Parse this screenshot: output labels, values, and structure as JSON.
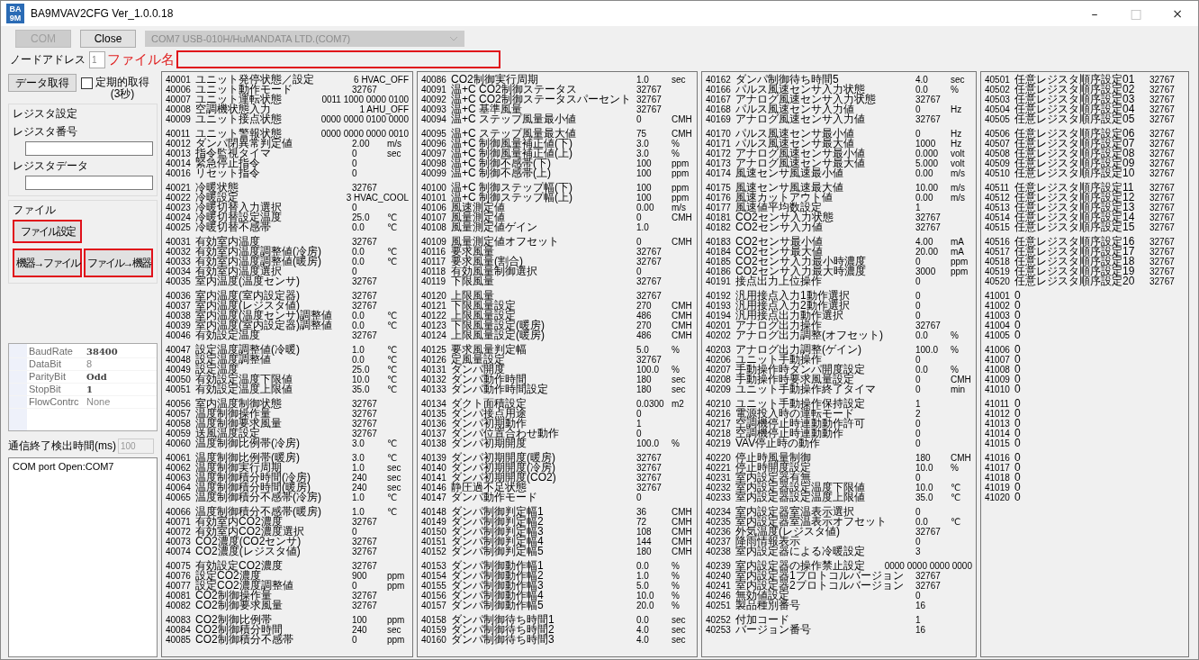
{
  "window": {
    "title": "BA9MVAV2CFG Ver_1.0.0.18",
    "icon_text": [
      "BA",
      "9M"
    ],
    "controls": [
      "–",
      "□",
      "×"
    ]
  },
  "connection": {
    "com_button": {
      "label": "COM",
      "disabled": true
    },
    "close_button": {
      "label": "Close",
      "disabled": false
    },
    "port_select": {
      "value": "COM7 USB-010H/HuMANDATA LTD.(COM7)",
      "disabled": true
    }
  },
  "node_address": {
    "label": "ノードアドレス",
    "value": "1"
  },
  "file_name": {
    "label": "ファイル名",
    "highlighted": true
  },
  "fetch_button": {
    "label": "データ取得"
  },
  "periodic": {
    "label": "定期的取得",
    "sublabel": "(3秒)",
    "checked": false
  },
  "register_settings": {
    "title": "レジスタ設定",
    "fields": [
      {
        "label": "レジスタ番号"
      },
      {
        "label": "レジスタデータ"
      }
    ]
  },
  "file": {
    "title": "ファイル",
    "buttons": [
      {
        "label": "ファイル設定",
        "highlighted": true
      },
      {
        "label": "機器→ファイル",
        "highlighted": true
      },
      {
        "label": "ファイル→機器",
        "highlighted": true
      }
    ]
  },
  "serial_properties": [
    {
      "name": "BaudRate",
      "value": "38400",
      "modified": true
    },
    {
      "name": "DataBit",
      "value": "8",
      "modified": false
    },
    {
      "name": "ParityBit",
      "value": "Odd",
      "modified": true
    },
    {
      "name": "StopBit",
      "value": "1",
      "modified": true
    },
    {
      "name": "FlowContrc",
      "value": "None",
      "modified": false
    }
  ],
  "timeout": {
    "label": "通信終了検出時間(ms)",
    "value": "100",
    "disabled": true
  },
  "log": [
    "COM port Open:COM7"
  ],
  "panels": [
    {
      "groups": [
        [
          {
            "reg": "40001",
            "name": "ユニット発停状態／設定",
            "value": "6 HVAC_OFF"
          },
          {
            "reg": "40006",
            "name": "ユニット動作モード",
            "value": "32767"
          },
          {
            "reg": "40007",
            "name": "ユニット運転状態",
            "value": "0011 1000 0000 0100"
          },
          {
            "reg": "40008",
            "name": "空調機状態入力",
            "value": "1 AHU_OFF"
          },
          {
            "reg": "40009",
            "name": "ユニット接点状態",
            "value": "0000 0000 0100 0000"
          }
        ],
        [
          {
            "reg": "40011",
            "name": "ユニット警報状態",
            "value": "0000 0000 0000 0010"
          },
          {
            "reg": "40012",
            "name": "ダンパ閉異常判定値",
            "value": "2.00",
            "unit": "m/s"
          },
          {
            "reg": "40013",
            "name": "指令監視タイマ",
            "value": "0",
            "unit": "sec"
          },
          {
            "reg": "40014",
            "name": "緊急停止指令",
            "value": "0"
          },
          {
            "reg": "40016",
            "name": "リセット指令",
            "value": "0"
          }
        ],
        [
          {
            "reg": "40021",
            "name": "冷暖状態",
            "value": "32767"
          },
          {
            "reg": "40022",
            "name": "冷暖設定",
            "value": "3 HVAC_COOL"
          },
          {
            "reg": "40023",
            "name": "冷暖切替入力選択",
            "value": "0"
          },
          {
            "reg": "40024",
            "name": "冷暖切替設定温度",
            "value": "25.0",
            "unit": "℃"
          },
          {
            "reg": "40025",
            "name": "冷暖切替不感帯",
            "value": "0.0",
            "unit": "℃"
          }
        ],
        [
          {
            "reg": "40031",
            "name": "有効室内温度",
            "value": "32767"
          },
          {
            "reg": "40032",
            "name": "有効室内温度調整値(冷房)",
            "value": "0.0",
            "unit": "℃"
          },
          {
            "reg": "40033",
            "name": "有効室内温度調整値(暖房)",
            "value": "0.0",
            "unit": "℃"
          },
          {
            "reg": "40034",
            "name": "有効室内温度選択",
            "value": "0"
          },
          {
            "reg": "40035",
            "name": "室内温度(温度センサ)",
            "value": "32767"
          }
        ],
        [
          {
            "reg": "40036",
            "name": "室内温度(室内設定器)",
            "value": "32767"
          },
          {
            "reg": "40037",
            "name": "室内温度(レジスタ値)",
            "value": "32767"
          },
          {
            "reg": "40038",
            "name": "室内温度(温度センサ)調整値",
            "value": "0.0",
            "unit": "℃"
          },
          {
            "reg": "40039",
            "name": "室内温度(室内設定器)調整値",
            "value": "0.0",
            "unit": "℃"
          },
          {
            "reg": "40046",
            "name": "有効設定温度",
            "value": "32767"
          }
        ],
        [
          {
            "reg": "40047",
            "name": "設定温度調整値(冷暖)",
            "value": "1.0",
            "unit": "℃"
          },
          {
            "reg": "40048",
            "name": "設定温度調整値",
            "value": "0.0",
            "unit": "℃"
          },
          {
            "reg": "40049",
            "name": "設定温度",
            "value": "25.0",
            "unit": "℃"
          },
          {
            "reg": "40050",
            "name": "有効設定温度下限値",
            "value": "10.0",
            "unit": "℃"
          },
          {
            "reg": "40051",
            "name": "有効設定温度上限値",
            "value": "35.0",
            "unit": "℃"
          }
        ],
        [
          {
            "reg": "40056",
            "name": "室内温度制御状態",
            "value": "32767"
          },
          {
            "reg": "40057",
            "name": "温度制御操作量",
            "value": "32767"
          },
          {
            "reg": "40058",
            "name": "温度制御要求風量",
            "value": "32767"
          },
          {
            "reg": "40059",
            "name": "送風温度設定",
            "value": "32767"
          },
          {
            "reg": "40060",
            "name": "温度制御比例帯(冷房)",
            "value": "3.0",
            "unit": "℃"
          }
        ],
        [
          {
            "reg": "40061",
            "name": "温度制御比例帯(暖房)",
            "value": "3.0",
            "unit": "℃"
          },
          {
            "reg": "40062",
            "name": "温度制御実行周期",
            "value": "1.0",
            "unit": "sec"
          },
          {
            "reg": "40063",
            "name": "温度制御積分時間(冷房)",
            "value": "240",
            "unit": "sec"
          },
          {
            "reg": "40064",
            "name": "温度制御積分時間(暖房)",
            "value": "240",
            "unit": "sec"
          },
          {
            "reg": "40065",
            "name": "温度制御積分不感帯(冷房)",
            "value": "1.0",
            "unit": "℃"
          }
        ],
        [
          {
            "reg": "40066",
            "name": "温度制御積分不感帯(暖房)",
            "value": "1.0",
            "unit": "℃"
          },
          {
            "reg": "40071",
            "name": "有効室内CO2濃度",
            "value": "32767"
          },
          {
            "reg": "40072",
            "name": "有効室内CO2濃度選択",
            "value": "0"
          },
          {
            "reg": "40073",
            "name": "CO2濃度(CO2センサ)",
            "value": "32767"
          },
          {
            "reg": "40074",
            "name": "CO2濃度(レジスタ値)",
            "value": "32767"
          }
        ],
        [
          {
            "reg": "40075",
            "name": "有効設定CO2濃度",
            "value": "32767"
          },
          {
            "reg": "40076",
            "name": "設定CO2濃度",
            "value": "900",
            "unit": "ppm"
          },
          {
            "reg": "40077",
            "name": "設定CO2濃度調整値",
            "value": "0",
            "unit": "ppm"
          },
          {
            "reg": "40081",
            "name": "CO2制御操作量",
            "value": "32767"
          },
          {
            "reg": "40082",
            "name": "CO2制御要求風量",
            "value": "32767"
          }
        ],
        [
          {
            "reg": "40083",
            "name": "CO2制御比例帯",
            "value": "100",
            "unit": "ppm"
          },
          {
            "reg": "40084",
            "name": "CO2制御積分時間",
            "value": "240",
            "unit": "sec"
          },
          {
            "reg": "40085",
            "name": "CO2制御積分不感帯",
            "value": "0",
            "unit": "ppm"
          }
        ]
      ]
    },
    {
      "groups": [
        [
          {
            "reg": "40086",
            "name": "CO2制御実行周期",
            "value": "1.0",
            "unit": "sec"
          },
          {
            "reg": "40091",
            "name": "温+C CO2制御ステータス",
            "value": "32767"
          },
          {
            "reg": "40092",
            "name": "温+C CO2制御ステータスパーセント",
            "value": "32767"
          },
          {
            "reg": "40093",
            "name": "温+C 基準風量",
            "value": "32767"
          },
          {
            "reg": "40094",
            "name": "温+C ステップ風量最小値",
            "value": "0",
            "unit": "CMH"
          }
        ],
        [
          {
            "reg": "40095",
            "name": "温+C ステップ風量最大値",
            "value": "75",
            "unit": "CMH"
          },
          {
            "reg": "40096",
            "name": "温+C 制御風量補正値(下)",
            "value": "3.0",
            "unit": "%"
          },
          {
            "reg": "40097",
            "name": "温+C 制御風量補正値(上)",
            "value": "3.0",
            "unit": "%"
          },
          {
            "reg": "40098",
            "name": "温+C 制御不感帯(下)",
            "value": "100",
            "unit": "ppm"
          },
          {
            "reg": "40099",
            "name": "温+C 制御不感帯(上)",
            "value": "100",
            "unit": "ppm"
          }
        ],
        [
          {
            "reg": "40100",
            "name": "温+C 制御ステップ幅(下)",
            "value": "100",
            "unit": "ppm"
          },
          {
            "reg": "40101",
            "name": "温+C 制御ステップ幅(上)",
            "value": "100",
            "unit": "ppm"
          },
          {
            "reg": "40106",
            "name": "風速測定値",
            "value": "0.00",
            "unit": "m/s"
          },
          {
            "reg": "40107",
            "name": "風量測定値",
            "value": "0",
            "unit": "CMH"
          },
          {
            "reg": "40108",
            "name": "風量測定値ゲイン",
            "value": "1.0"
          }
        ],
        [
          {
            "reg": "40109",
            "name": "風量測定値オフセット",
            "value": "0",
            "unit": "CMH"
          },
          {
            "reg": "40116",
            "name": "要求風量",
            "value": "32767"
          },
          {
            "reg": "40117",
            "name": "要求風量(割合)",
            "value": "32767"
          },
          {
            "reg": "40118",
            "name": "有効風量制御選択",
            "value": "0"
          },
          {
            "reg": "40119",
            "name": "下限風量",
            "value": "32767"
          }
        ],
        [
          {
            "reg": "40120",
            "name": "上限風量",
            "value": "32767"
          },
          {
            "reg": "40121",
            "name": "下限風量設定",
            "value": "270",
            "unit": "CMH"
          },
          {
            "reg": "40122",
            "name": "上限風量設定",
            "value": "486",
            "unit": "CMH"
          },
          {
            "reg": "40123",
            "name": "下限風量設定(暖房)",
            "value": "270",
            "unit": "CMH"
          },
          {
            "reg": "40124",
            "name": "上限風量設定(暖房)",
            "value": "486",
            "unit": "CMH"
          }
        ],
        [
          {
            "reg": "40125",
            "name": "要求風量判定幅",
            "value": "5.0",
            "unit": "%"
          },
          {
            "reg": "40126",
            "name": "定風量設定",
            "value": "32767"
          },
          {
            "reg": "40131",
            "name": "ダンパ開度",
            "value": "100.0",
            "unit": "%"
          },
          {
            "reg": "40132",
            "name": "ダンパ動作時間",
            "value": "180",
            "unit": "sec"
          },
          {
            "reg": "40133",
            "name": "ダンパ動作時間設定",
            "value": "180",
            "unit": "sec"
          }
        ],
        [
          {
            "reg": "40134",
            "name": "ダクト面積設定",
            "value": "0.0300",
            "unit": "m2"
          },
          {
            "reg": "40135",
            "name": "ダンパ接点用途",
            "value": "0"
          },
          {
            "reg": "40136",
            "name": "ダンパ初期動作",
            "value": "1"
          },
          {
            "reg": "40137",
            "name": "ダンパ位置合わせ動作",
            "value": "0"
          },
          {
            "reg": "40138",
            "name": "ダンパ初期開度",
            "value": "100.0",
            "unit": "%"
          }
        ],
        [
          {
            "reg": "40139",
            "name": "ダンパ初期開度(暖房)",
            "value": "32767"
          },
          {
            "reg": "40140",
            "name": "ダンパ初期開度(冷房)",
            "value": "32767"
          },
          {
            "reg": "40141",
            "name": "ダンパ初期開度(CO2)",
            "value": "32767"
          },
          {
            "reg": "40146",
            "name": "静圧過不足状態",
            "value": "32767"
          },
          {
            "reg": "40147",
            "name": "ダンパ動作モード",
            "value": "0"
          }
        ],
        [
          {
            "reg": "40148",
            "name": "ダンパ制御判定幅1",
            "value": "36",
            "unit": "CMH"
          },
          {
            "reg": "40149",
            "name": "ダンパ制御判定幅2",
            "value": "72",
            "unit": "CMH"
          },
          {
            "reg": "40150",
            "name": "ダンパ制御判定幅3",
            "value": "108",
            "unit": "CMH"
          },
          {
            "reg": "40151",
            "name": "ダンパ制御判定幅4",
            "value": "144",
            "unit": "CMH"
          },
          {
            "reg": "40152",
            "name": "ダンパ制御判定幅5",
            "value": "180",
            "unit": "CMH"
          }
        ],
        [
          {
            "reg": "40153",
            "name": "ダンパ制御動作幅1",
            "value": "0.0",
            "unit": "%"
          },
          {
            "reg": "40154",
            "name": "ダンパ制御動作幅2",
            "value": "1.0",
            "unit": "%"
          },
          {
            "reg": "40155",
            "name": "ダンパ制御動作幅3",
            "value": "5.0",
            "unit": "%"
          },
          {
            "reg": "40156",
            "name": "ダンパ制御動作幅4",
            "value": "10.0",
            "unit": "%"
          },
          {
            "reg": "40157",
            "name": "ダンパ制御動作幅5",
            "value": "20.0",
            "unit": "%"
          }
        ],
        [
          {
            "reg": "40158",
            "name": "ダンパ制御待ち時間1",
            "value": "0.0",
            "unit": "sec"
          },
          {
            "reg": "40159",
            "name": "ダンパ制御待ち時間2",
            "value": "4.0",
            "unit": "sec"
          },
          {
            "reg": "40160",
            "name": "ダンパ制御待ち時間3",
            "value": "4.0",
            "unit": "sec"
          }
        ]
      ]
    },
    {
      "groups": [
        [
          {
            "reg": "40162",
            "name": "ダンパ制御待ち時間5",
            "value": "4.0",
            "unit": "sec"
          },
          {
            "reg": "40166",
            "name": "パルス風速センサ入力状態",
            "value": "0.0",
            "unit": "%"
          },
          {
            "reg": "40167",
            "name": "アナログ風速センサ入力状態",
            "value": "32767"
          },
          {
            "reg": "40168",
            "name": "パルス風速センサ入力値",
            "value": "0",
            "unit": "Hz"
          },
          {
            "reg": "40169",
            "name": "アナログ風速センサ入力値",
            "value": "32767"
          }
        ],
        [
          {
            "reg": "40170",
            "name": "パルス風速センサ最小値",
            "value": "0",
            "unit": "Hz"
          },
          {
            "reg": "40171",
            "name": "パルス風速センサ最大値",
            "value": "1000",
            "unit": "Hz"
          },
          {
            "reg": "40172",
            "name": "アナログ風速センサ最小値",
            "value": "0.000",
            "unit": "volt"
          },
          {
            "reg": "40173",
            "name": "アナログ風速センサ最大値",
            "value": "5.000",
            "unit": "volt"
          },
          {
            "reg": "40174",
            "name": "風速センサ風速最小値",
            "value": "0.00",
            "unit": "m/s"
          }
        ],
        [
          {
            "reg": "40175",
            "name": "風速センサ風速最大値",
            "value": "10.00",
            "unit": "m/s"
          },
          {
            "reg": "40176",
            "name": "風速カットアウト値",
            "value": "0.00",
            "unit": "m/s"
          },
          {
            "reg": "40177",
            "name": "風速値平均数設定",
            "value": "1"
          },
          {
            "reg": "40181",
            "name": "CO2センサ入力状態",
            "value": "32767"
          },
          {
            "reg": "40182",
            "name": "CO2センサ入力値",
            "value": "32767"
          }
        ],
        [
          {
            "reg": "40183",
            "name": "CO2センサ最小値",
            "value": "4.00",
            "unit": "mA"
          },
          {
            "reg": "40184",
            "name": "CO2センサ最大値",
            "value": "20.00",
            "unit": "mA"
          },
          {
            "reg": "40185",
            "name": "CO2センサ入力最小時濃度",
            "value": "0",
            "unit": "ppm"
          },
          {
            "reg": "40186",
            "name": "CO2センサ入力最大時濃度",
            "value": "3000",
            "unit": "ppm"
          },
          {
            "reg": "40191",
            "name": "接点出力上位操作",
            "value": "0"
          }
        ],
        [
          {
            "reg": "40192",
            "name": "汎用接点入力1動作選択",
            "value": "0"
          },
          {
            "reg": "40193",
            "name": "汎用接点入力2動作選択",
            "value": "0"
          },
          {
            "reg": "40194",
            "name": "汎用接点出力動作選択",
            "value": "0"
          },
          {
            "reg": "40201",
            "name": "アナログ出力操作",
            "value": "32767"
          },
          {
            "reg": "40202",
            "name": "アナログ出力調整(オフセット)",
            "value": "0.0",
            "unit": "%"
          }
        ],
        [
          {
            "reg": "40203",
            "name": "アナログ出力調整(ゲイン)",
            "value": "100.0",
            "unit": "%"
          },
          {
            "reg": "40206",
            "name": "ユニット手動操作",
            "value": "0"
          },
          {
            "reg": "40207",
            "name": "手動操作時ダンパ開度設定",
            "value": "0.0",
            "unit": "%"
          },
          {
            "reg": "40208",
            "name": "手動操作時要求風量設定",
            "value": "0",
            "unit": "CMH"
          },
          {
            "reg": "40209",
            "name": "ユニット手動操作終了タイマ",
            "value": "0",
            "unit": "min"
          }
        ],
        [
          {
            "reg": "40210",
            "name": "ユニット手動操作保持設定",
            "value": "1"
          },
          {
            "reg": "40216",
            "name": "電源投入時の運転モード",
            "value": "2"
          },
          {
            "reg": "40217",
            "name": "空調機停止時連動動作許可",
            "value": "0"
          },
          {
            "reg": "40218",
            "name": "空調機停止時連動動作",
            "value": "0"
          },
          {
            "reg": "40219",
            "name": "VAV停止時の動作",
            "value": "0"
          }
        ],
        [
          {
            "reg": "40220",
            "name": "停止時風量制御",
            "value": "180",
            "unit": "CMH"
          },
          {
            "reg": "40221",
            "name": "停止時開度設定",
            "value": "10.0",
            "unit": "%"
          },
          {
            "reg": "40231",
            "name": "室内設定器有無",
            "value": "0"
          },
          {
            "reg": "40232",
            "name": "室内設定器設定温度下限値",
            "value": "10.0",
            "unit": "℃"
          },
          {
            "reg": "40233",
            "name": "室内設定器設定温度上限値",
            "value": "35.0",
            "unit": "℃"
          }
        ],
        [
          {
            "reg": "40234",
            "name": "室内設定器室温表示選択",
            "value": "0"
          },
          {
            "reg": "40235",
            "name": "室内設定器室温表示オフセット",
            "value": "0.0",
            "unit": "℃"
          },
          {
            "reg": "40236",
            "name": "外気温度(レジスタ値)",
            "value": "32767"
          },
          {
            "reg": "40237",
            "name": "降雨情報表示",
            "value": "0"
          },
          {
            "reg": "40238",
            "name": "室内設定器による冷暖設定",
            "value": "3"
          }
        ],
        [
          {
            "reg": "40239",
            "name": "室内設定器の操作禁止設定",
            "value": "0000 0000 0000 0000"
          },
          {
            "reg": "40240",
            "name": "室内設定器1プロトコルバージョン",
            "value": "32767"
          },
          {
            "reg": "40241",
            "name": "室内設定器2プロトコルバージョン",
            "value": "32767"
          },
          {
            "reg": "40246",
            "name": "無効値設定",
            "value": "0"
          },
          {
            "reg": "40251",
            "name": "製品種別番号",
            "value": "16"
          }
        ],
        [
          {
            "reg": "40252",
            "name": "付加コード",
            "value": "1"
          },
          {
            "reg": "40253",
            "name": "バージョン番号",
            "value": "16"
          }
        ]
      ]
    },
    {
      "groups": [
        [
          {
            "reg": "40501",
            "name": "任意レジスタ順序設定01",
            "value": "32767"
          },
          {
            "reg": "40502",
            "name": "任意レジスタ順序設定02",
            "value": "32767"
          },
          {
            "reg": "40503",
            "name": "任意レジスタ順序設定03",
            "value": "32767"
          },
          {
            "reg": "40504",
            "name": "任意レジスタ順序設定04",
            "value": "32767"
          },
          {
            "reg": "40505",
            "name": "任意レジスタ順序設定05",
            "value": "32767"
          }
        ],
        [
          {
            "reg": "40506",
            "name": "任意レジスタ順序設定06",
            "value": "32767"
          },
          {
            "reg": "40507",
            "name": "任意レジスタ順序設定07",
            "value": "32767"
          },
          {
            "reg": "40508",
            "name": "任意レジスタ順序設定08",
            "value": "32767"
          },
          {
            "reg": "40509",
            "name": "任意レジスタ順序設定09",
            "value": "32767"
          },
          {
            "reg": "40510",
            "name": "任意レジスタ順序設定10",
            "value": "32767"
          }
        ],
        [
          {
            "reg": "40511",
            "name": "任意レジスタ順序設定11",
            "value": "32767"
          },
          {
            "reg": "40512",
            "name": "任意レジスタ順序設定12",
            "value": "32767"
          },
          {
            "reg": "40513",
            "name": "任意レジスタ順序設定13",
            "value": "32767"
          },
          {
            "reg": "40514",
            "name": "任意レジスタ順序設定14",
            "value": "32767"
          },
          {
            "reg": "40515",
            "name": "任意レジスタ順序設定15",
            "value": "32767"
          }
        ],
        [
          {
            "reg": "40516",
            "name": "任意レジスタ順序設定16",
            "value": "32767"
          },
          {
            "reg": "40517",
            "name": "任意レジスタ順序設定17",
            "value": "32767"
          },
          {
            "reg": "40518",
            "name": "任意レジスタ順序設定18",
            "value": "32767"
          },
          {
            "reg": "40519",
            "name": "任意レジスタ順序設定19",
            "value": "32767"
          },
          {
            "reg": "40520",
            "name": "任意レジスタ順序設定20",
            "value": "32767"
          }
        ],
        [
          {
            "reg": "41001",
            "name": "0"
          },
          {
            "reg": "41002",
            "name": "0"
          },
          {
            "reg": "41003",
            "name": "0"
          },
          {
            "reg": "41004",
            "name": "0"
          },
          {
            "reg": "41005",
            "name": "0"
          }
        ],
        [
          {
            "reg": "41006",
            "name": "0"
          },
          {
            "reg": "41007",
            "name": "0"
          },
          {
            "reg": "41008",
            "name": "0"
          },
          {
            "reg": "41009",
            "name": "0"
          },
          {
            "reg": "41010",
            "name": "0"
          }
        ],
        [
          {
            "reg": "41011",
            "name": "0"
          },
          {
            "reg": "41012",
            "name": "0"
          },
          {
            "reg": "41013",
            "name": "0"
          },
          {
            "reg": "41014",
            "name": "0"
          },
          {
            "reg": "41015",
            "name": "0"
          }
        ],
        [
          {
            "reg": "41016",
            "name": "0"
          },
          {
            "reg": "41017",
            "name": "0"
          },
          {
            "reg": "41018",
            "name": "0"
          },
          {
            "reg": "41019",
            "name": "0"
          },
          {
            "reg": "41020",
            "name": "0"
          }
        ]
      ]
    }
  ]
}
